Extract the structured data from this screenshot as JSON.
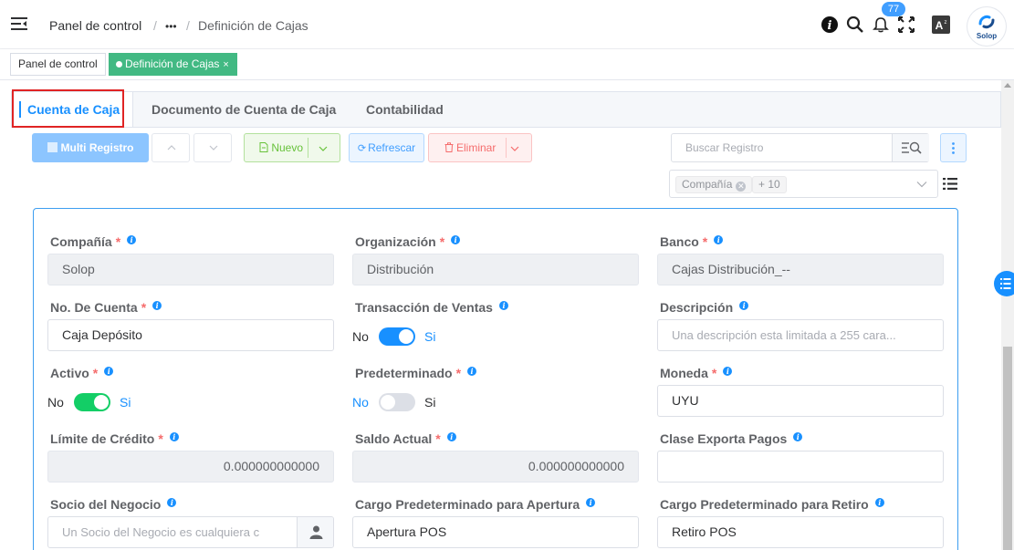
{
  "header": {
    "breadcrumb_home": "Panel de control",
    "breadcrumb_sep1": "/",
    "breadcrumb_more": "•••",
    "breadcrumb_sep2": "/",
    "breadcrumb_current": "Definición de Cajas",
    "notifications_count": "77",
    "avatar_label": "Solop"
  },
  "tags": {
    "home": "Panel de control",
    "active": "Definición de Cajas",
    "close": "×"
  },
  "tabs": [
    "Cuenta de Caja",
    "Documento de Cuenta de Caja",
    "Contabilidad"
  ],
  "toolbar": {
    "multi": "Multi Registro",
    "nuevo": "Nuevo",
    "refrescar": "Refrescar",
    "eliminar": "Eliminar",
    "search_placeholder": "Buscar Registro",
    "filter_tag": "Compañía",
    "filter_more": "+ 10"
  },
  "form": {
    "compania": {
      "label": "Compañía",
      "value": "Solop"
    },
    "organizacion": {
      "label": "Organización",
      "value": "Distribución"
    },
    "banco": {
      "label": "Banco",
      "value": "Cajas Distribución_--"
    },
    "cuenta": {
      "label": "No. De Cuenta",
      "value": "Caja Depósito"
    },
    "transaccion": {
      "label": "Transacción de Ventas",
      "off": "No",
      "on": "Si",
      "state": true
    },
    "descripcion": {
      "label": "Descripción",
      "placeholder": "Una descripción esta limitada a 255 cara..."
    },
    "activo": {
      "label": "Activo",
      "off": "No",
      "on": "Si",
      "state": true
    },
    "predeterminado": {
      "label": "Predeterminado",
      "off": "No",
      "on": "Si",
      "state": false
    },
    "moneda": {
      "label": "Moneda",
      "value": "UYU"
    },
    "limite": {
      "label": "Límite de Crédito",
      "value": "0.000000000000"
    },
    "saldo": {
      "label": "Saldo Actual",
      "value": "0.000000000000"
    },
    "clase": {
      "label": "Clase Exporta Pagos",
      "value": ""
    },
    "socio": {
      "label": "Socio del Negocio",
      "placeholder": "Un Socio del Negocio es cualquiera c"
    },
    "apertura": {
      "label": "Cargo Predeterminado para Apertura",
      "value": "Apertura POS"
    },
    "retiro": {
      "label": "Cargo Predeterminado para Retiro",
      "value": "Retiro POS"
    }
  },
  "colors": {
    "primary": "#1890ff",
    "success": "#42b983",
    "switch_on_blue": "#1890ff",
    "switch_on_green": "#13ce66",
    "danger": "#f56c6c",
    "highlight": "#e02424"
  }
}
